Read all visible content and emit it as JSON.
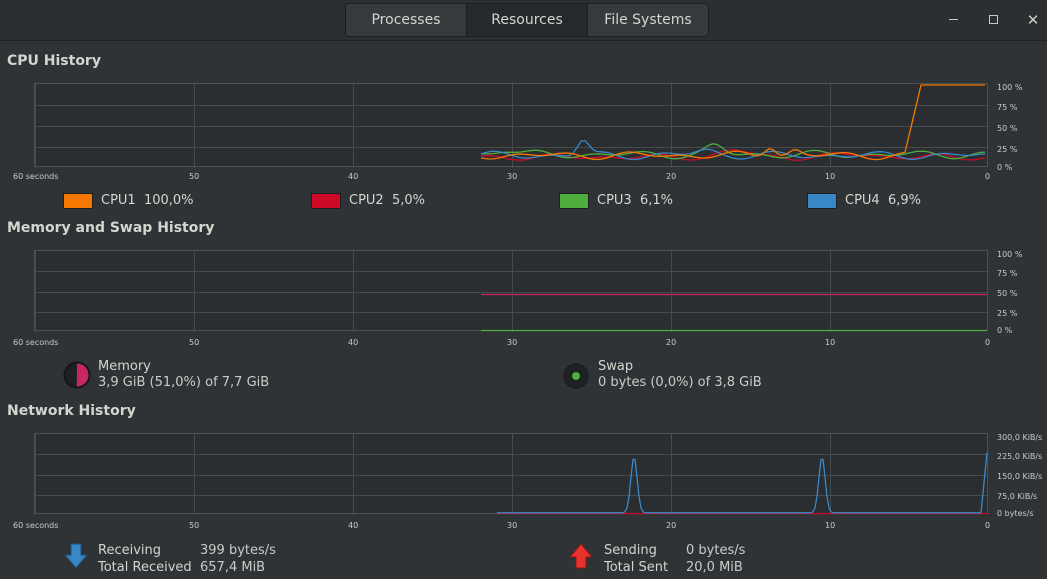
{
  "tabs": [
    {
      "label": "Processes"
    },
    {
      "label": "Resources"
    },
    {
      "label": "File Systems"
    }
  ],
  "window_controls": {
    "minimize": "–",
    "maximize": "□",
    "close": "×"
  },
  "x_axis": {
    "start_label": "60 seconds",
    "ticks": [
      "50",
      "40",
      "30",
      "20",
      "10",
      "0"
    ]
  },
  "cpu": {
    "title": "CPU History",
    "y_ticks": [
      "100 %",
      "75 %",
      "50 %",
      "25 %",
      "0 %"
    ],
    "legend": [
      {
        "label": "CPU1",
        "value": "100,0%",
        "color": "#f57900"
      },
      {
        "label": "CPU2",
        "value": "5,0%",
        "color": "#cc0a28"
      },
      {
        "label": "CPU3",
        "value": "6,1%",
        "color": "#4eaf3c"
      },
      {
        "label": "CPU4",
        "value": "6,9%",
        "color": "#3a87c7"
      }
    ]
  },
  "memory": {
    "title": "Memory and Swap History",
    "y_ticks": [
      "100 %",
      "75 %",
      "50 %",
      "25 %",
      "0 %"
    ],
    "memory_label": "Memory",
    "memory_value": "3,9 GiB (51,0%) of 7,7 GiB",
    "memory_color": "#c8285f",
    "swap_label": "Swap",
    "swap_value": "0 bytes (0,0%) of 3,8 GiB",
    "swap_color": "#4eaf3c"
  },
  "network": {
    "title": "Network History",
    "y_ticks": [
      "300,0 KiB/s",
      "225,0 KiB/s",
      "150,0 KiB/s",
      "75,0 KiB/s",
      "0 bytes/s"
    ],
    "receiving_label": "Receiving",
    "receiving_value": "399 bytes/s",
    "total_received_label": "Total Received",
    "total_received_value": "657,4 MiB",
    "sending_label": "Sending",
    "sending_value": "0 bytes/s",
    "total_sent_label": "Total Sent",
    "total_sent_value": "20,0 MiB",
    "receive_color": "#3a87c7",
    "send_color": "#cc0a28"
  }
}
